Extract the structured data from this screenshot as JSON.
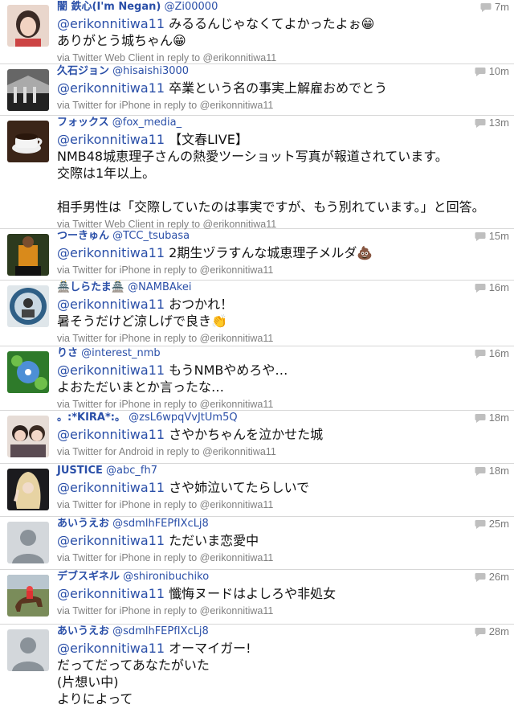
{
  "tweets": [
    {
      "name": "闇 鉄心(I'm Negan)",
      "handle": "@Zi00000",
      "time": "7m",
      "mention": "@erikonnitiwa11",
      "text": " みるるんじゃなくてよかったよぉ😁\nありがとう城ちゃん😁",
      "client": "via Twitter Web Client in reply to @erikonnitiwa11",
      "avatar": "photo-woman-icon"
    },
    {
      "name": "久石ジョン",
      "handle": "@hisaishi3000",
      "time": "10m",
      "mention": "@erikonnitiwa11",
      "text": " 卒業という名の事実上解雇おめでとう",
      "client": "via Twitter for iPhone in reply to @erikonnitiwa11",
      "avatar": "bw-photo-icon"
    },
    {
      "name": "フォックス",
      "handle": "@fox_media_",
      "time": "13m",
      "mention": "@erikonnitiwa11",
      "text": " 【文春LIVE】\nNMB48城恵理子さんの熱愛ツーショット写真が報道されています。\n交際は1年以上。\n\n相手男性は「交際していたのは事実ですが、もう別れています。」と回答。",
      "client": "via Twitter Web Client in reply to @erikonnitiwa11",
      "avatar": "coffee-cup-icon"
    },
    {
      "name": "つーきゅん",
      "handle": "@TCC_tsubasa",
      "time": "15m",
      "mention": "@erikonnitiwa11",
      "text": " 2期生ヅラすんな城恵理子メルダ💩",
      "client": "via Twitter for iPhone in reply to @erikonnitiwa11",
      "avatar": "soccer-player-icon"
    },
    {
      "name": "🏯しらたま🏯",
      "handle": "@NAMBAkei",
      "time": "16m",
      "mention": "@erikonnitiwa11",
      "text": " おつかれ！\n暑そうだけど涼しげで良き👏",
      "client": "via Twitter for iPhone in reply to @erikonnitiwa11",
      "avatar": "circle-photo-icon"
    },
    {
      "name": "りさ",
      "handle": "@interest_nmb",
      "time": "16m",
      "mention": "@erikonnitiwa11",
      "text": " もうNMBやめろや…\nよおただいまとか言ったな…",
      "client": "via Twitter for iPhone in reply to @erikonnitiwa11",
      "avatar": "flower-icon"
    },
    {
      "name": "。:*KIRA*:。",
      "handle": "@zsL6wpqVvJtUm5Q",
      "time": "18m",
      "mention": "@erikonnitiwa11",
      "text": " さやかちゃんを泣かせた城",
      "client": "via Twitter for Android in reply to @erikonnitiwa11",
      "avatar": "two-girls-icon"
    },
    {
      "name": "JUSTICE",
      "handle": "@abc_fh7",
      "time": "18m",
      "mention": "@erikonnitiwa11",
      "text": " さや姉泣いてたらしいで",
      "client": "via Twitter for iPhone in reply to @erikonnitiwa11",
      "avatar": "peace-sign-icon"
    },
    {
      "name": "あいうえお",
      "handle": "@sdmlhFEPfIXcLj8",
      "time": "25m",
      "mention": "@erikonnitiwa11",
      "text": " ただいま恋愛中",
      "client": "via Twitter for iPhone in reply to @erikonnitiwa11",
      "avatar": "default-user-icon"
    },
    {
      "name": "デブスギネル",
      "handle": "@shironibuchiko",
      "time": "26m",
      "mention": "@erikonnitiwa11",
      "text": " 懺悔ヌードはよしろや非処女",
      "client": "via Twitter for iPhone in reply to @erikonnitiwa11",
      "avatar": "horse-racing-icon"
    },
    {
      "name": "あいうえお",
      "handle": "@sdmlhFEPfIXcLj8",
      "time": "28m",
      "mention": "@erikonnitiwa11",
      "text": " オーマイガー!\nだってだってあなたがいた\n(片想い中)\nよりによって",
      "client": "",
      "avatar": "default-user-icon"
    }
  ]
}
